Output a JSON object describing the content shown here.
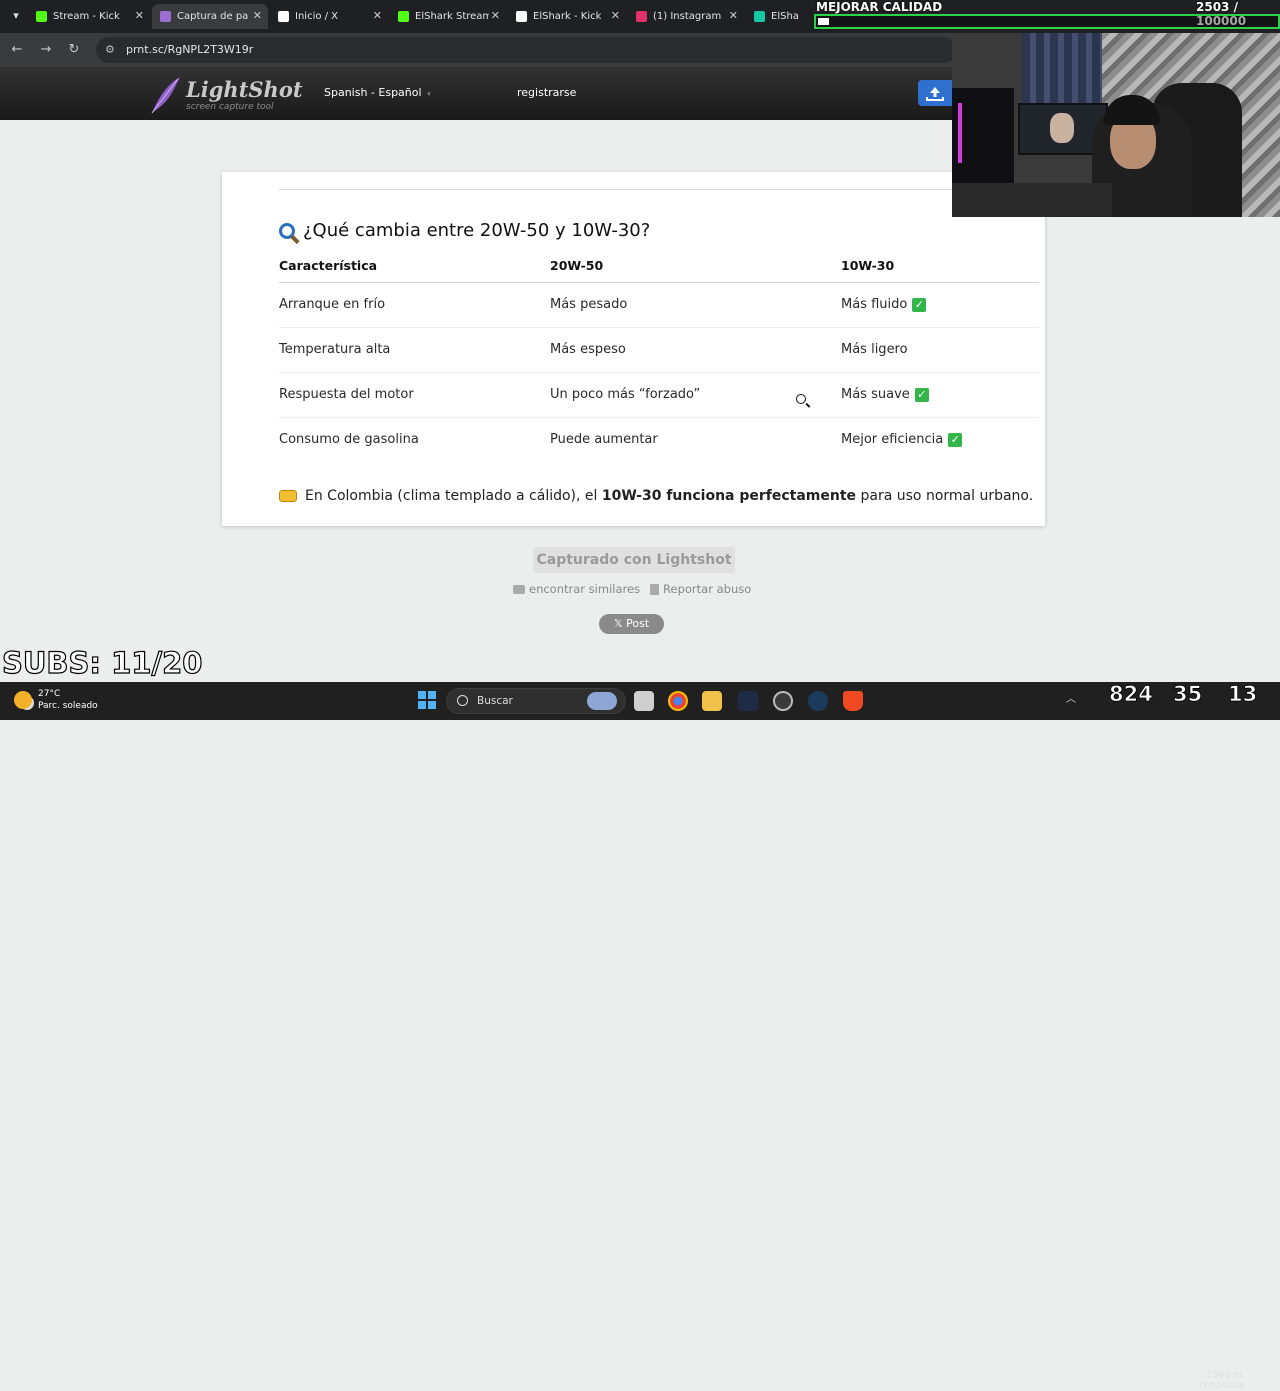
{
  "browser": {
    "tabs": [
      {
        "label": "Stream - Kick ",
        "icon": "kick-icon",
        "color": "#53fc18"
      },
      {
        "label": "Captura de pa",
        "icon": "lightshot-feather-icon",
        "color": "#9b6fd1",
        "active": true
      },
      {
        "label": "Inicio / X",
        "icon": "x-icon",
        "color": "#ffffff"
      },
      {
        "label": "ElShark Stream",
        "icon": "kick-icon",
        "color": "#53fc18"
      },
      {
        "label": "ElShark - Kick",
        "icon": "github-icon",
        "color": "#ffffff"
      },
      {
        "label": "(1) Instagram",
        "icon": "instagram-icon",
        "color": "#e1306c"
      },
      {
        "label": "ElShark_",
        "icon": "tt-icon",
        "color": "#14c7a5"
      }
    ],
    "url": "prnt.sc/RgNPL2T3W19r"
  },
  "lightshot": {
    "logo_word": "LightShot",
    "logo_tagline": "screen capture tool",
    "language": "Spanish - Español",
    "language_caret": "▾",
    "register": "registrarse"
  },
  "article": {
    "heading": "¿Qué cambia entre 20W-50 y 10W-30?",
    "columns": [
      "Característica",
      "20W-50",
      "10W-30"
    ],
    "rows": [
      {
        "feature": "Arranque en frío",
        "a": "Más pesado",
        "b": "Más fluido",
        "b_check": true
      },
      {
        "feature": "Temperatura alta",
        "a": "Más espeso",
        "b": "Más ligero",
        "b_check": false
      },
      {
        "feature": "Respuesta del motor",
        "a": "Un poco más “forzado”",
        "b": "Más suave",
        "b_check": true
      },
      {
        "feature": "Consumo de gasolina",
        "a": "Puede aumentar",
        "b": "Mejor eficiencia",
        "b_check": true
      }
    ],
    "note_before": "En Colombia (clima templado a cálido), el ",
    "note_bold": "10W-30 funciona perfectamente",
    "note_after": " para uso normal urbano."
  },
  "footer": {
    "captured": "Capturado con Lightshot",
    "similar": "encontrar similares",
    "report": "Reportar abuso",
    "post": "𝕏 Post"
  },
  "overlay": {
    "subs": "SUBS: 11/20",
    "quality_label": "MEJORAR CALIDAD",
    "quality_value": "2503 / 100000",
    "quality_progress": 0.025
  },
  "taskbar": {
    "temp": "27°C",
    "condition": "Parc. soleado",
    "search": "Buscar",
    "num1": "824",
    "num2": "35",
    "num3": "13",
    "time": "2:36 p.m.",
    "date": "27/02/2026"
  },
  "colors": {
    "accent_blue": "#2f6fd0",
    "check_green": "#33b54a",
    "progress_green": "#2bd24a"
  }
}
